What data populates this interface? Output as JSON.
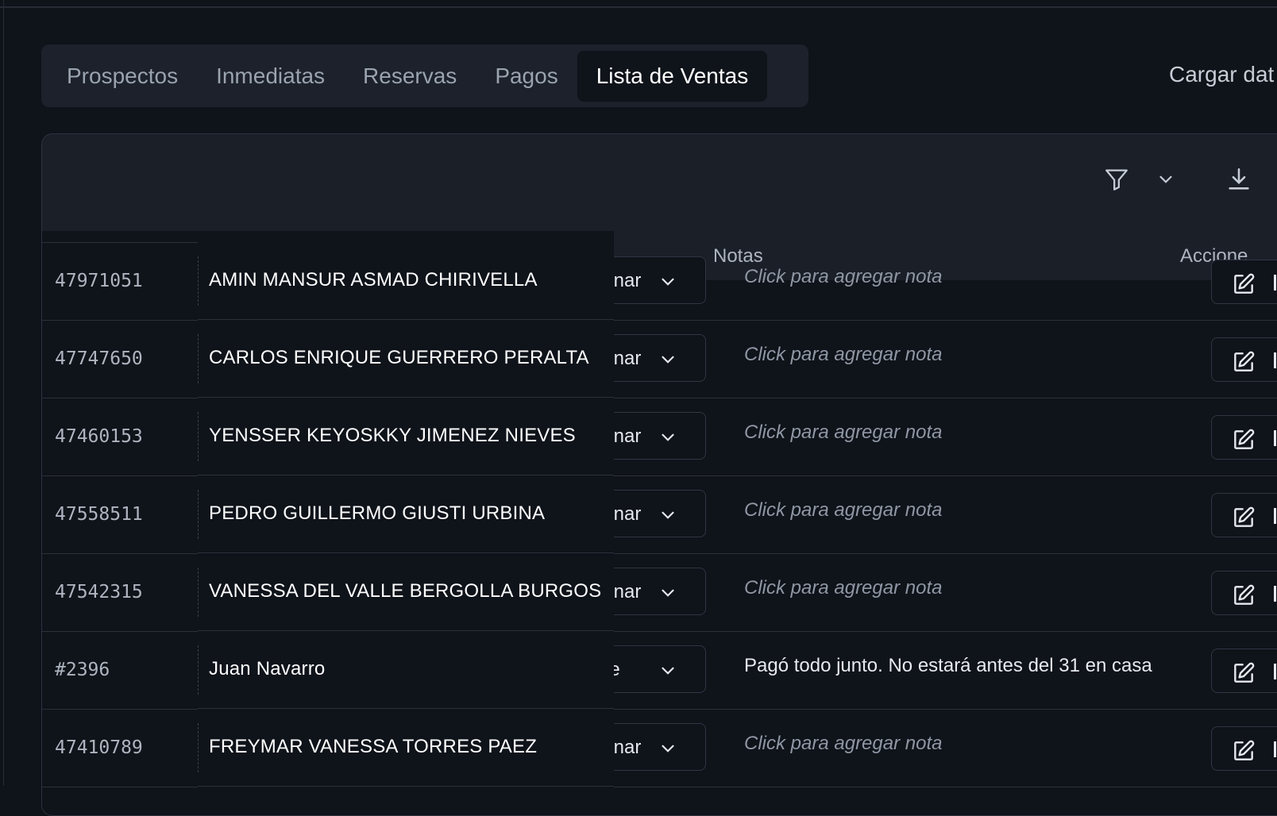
{
  "tabs": [
    {
      "label": "Prospectos",
      "active": false
    },
    {
      "label": "Inmediatas",
      "active": false
    },
    {
      "label": "Reservas",
      "active": false
    },
    {
      "label": "Pagos",
      "active": false
    },
    {
      "label": "Lista de Ventas",
      "active": true
    }
  ],
  "cargar_label": "Cargar dat",
  "toolbar": {
    "icons": [
      "filter-icon",
      "chevron-down-icon",
      "download-icon"
    ]
  },
  "table": {
    "headers": {
      "notas": "Notas",
      "acciones": "Accione"
    },
    "rows": [
      {
        "id": "47971051",
        "name": "AMIN MANSUR ASMAD CHIRIVELLA",
        "status": "ignar",
        "note": "Click para agregar nota",
        "note_placeholder": true
      },
      {
        "id": "47747650",
        "name": "CARLOS ENRIQUE GUERRERO PERALTA",
        "status": "ignar",
        "note": "Click para agregar nota",
        "note_placeholder": true
      },
      {
        "id": "47460153",
        "name": "YENSSER KEYOSKKY JIMENEZ NIEVES",
        "status": "ignar",
        "note": "Click para agregar nota",
        "note_placeholder": true
      },
      {
        "id": "47558511",
        "name": "PEDRO GUILLERMO GIUSTI URBINA",
        "status": "ignar",
        "note": "Click para agregar nota",
        "note_placeholder": true
      },
      {
        "id": "47542315",
        "name": "VANESSA DEL VALLE BERGOLLA BURGOS",
        "status": "ignar",
        "note": "Click para agregar nota",
        "note_placeholder": true
      },
      {
        "id": "#2396",
        "name": "Juan Navarro",
        "status": "ne",
        "note": "Pagó todo junto. No estará antes del 31 en casa",
        "note_placeholder": false
      },
      {
        "id": "47410789",
        "name": "FREYMAR VANESSA TORRES PAEZ",
        "status": "ignar",
        "note": "Click para agregar nota",
        "note_placeholder": true
      }
    ]
  },
  "colors": {
    "background": "#0f131a",
    "card": "#1a1f28",
    "border": "#2a313c",
    "muted": "#8f97a4"
  }
}
